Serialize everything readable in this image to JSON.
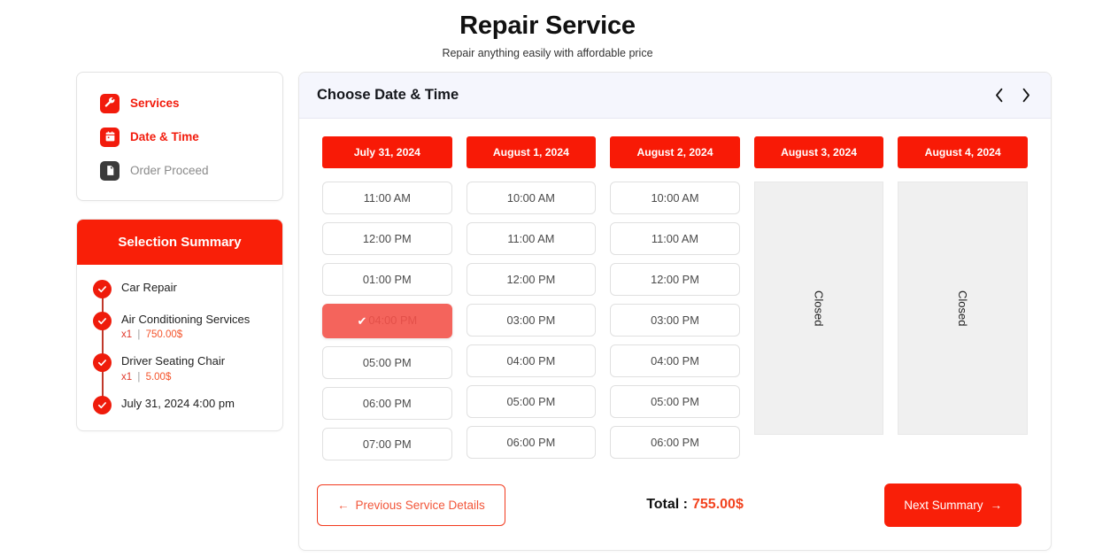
{
  "header": {
    "title": "Repair Service",
    "subtitle": "Repair anything easily with affordable price"
  },
  "sidebar": {
    "items": [
      {
        "label": "Services",
        "icon": "wrench-icon",
        "state": "active"
      },
      {
        "label": "Date & Time",
        "icon": "calendar-icon",
        "state": "active"
      },
      {
        "label": "Order Proceed",
        "icon": "document-icon",
        "state": "idle"
      }
    ]
  },
  "summary": {
    "title": "Selection Summary",
    "items": [
      {
        "name": "Car Repair",
        "qty": "",
        "sep": "",
        "price": ""
      },
      {
        "name": "Air Conditioning Services",
        "qty": "x1",
        "sep": "|",
        "price": "750.00$"
      },
      {
        "name": "Driver Seating Chair",
        "qty": "x1",
        "sep": "|",
        "price": "5.00$"
      },
      {
        "name": "July 31, 2024 4:00 pm",
        "qty": "",
        "sep": "",
        "price": ""
      }
    ]
  },
  "panel": {
    "title": "Choose Date & Time",
    "prev_icon": "chevron-left-icon",
    "next_icon": "chevron-right-icon"
  },
  "calendar": {
    "columns": [
      {
        "date": "July 31, 2024",
        "closed": false,
        "closed_label": "",
        "slots": [
          {
            "time": "11:00 AM",
            "selected": false
          },
          {
            "time": "12:00 PM",
            "selected": false
          },
          {
            "time": "01:00 PM",
            "selected": false
          },
          {
            "time": "04:00 PM",
            "selected": true
          },
          {
            "time": "05:00 PM",
            "selected": false
          },
          {
            "time": "06:00 PM",
            "selected": false
          },
          {
            "time": "07:00 PM",
            "selected": false
          }
        ]
      },
      {
        "date": "August 1, 2024",
        "closed": false,
        "closed_label": "",
        "slots": [
          {
            "time": "10:00 AM",
            "selected": false
          },
          {
            "time": "11:00 AM",
            "selected": false
          },
          {
            "time": "12:00 PM",
            "selected": false
          },
          {
            "time": "03:00 PM",
            "selected": false
          },
          {
            "time": "04:00 PM",
            "selected": false
          },
          {
            "time": "05:00 PM",
            "selected": false
          },
          {
            "time": "06:00 PM",
            "selected": false
          }
        ]
      },
      {
        "date": "August 2, 2024",
        "closed": false,
        "closed_label": "",
        "slots": [
          {
            "time": "10:00 AM",
            "selected": false
          },
          {
            "time": "11:00 AM",
            "selected": false
          },
          {
            "time": "12:00 PM",
            "selected": false
          },
          {
            "time": "03:00 PM",
            "selected": false
          },
          {
            "time": "04:00 PM",
            "selected": false
          },
          {
            "time": "05:00 PM",
            "selected": false
          },
          {
            "time": "06:00 PM",
            "selected": false
          }
        ]
      },
      {
        "date": "August 3, 2024",
        "closed": true,
        "closed_label": "Closed",
        "slots": []
      },
      {
        "date": "August 4, 2024",
        "closed": true,
        "closed_label": "Closed",
        "slots": []
      }
    ]
  },
  "footer": {
    "prev_label": "Previous Service Details",
    "prev_arrow": "←",
    "total_label": "Total :",
    "total_amount": "755.00$",
    "next_label": "Next Summary",
    "next_arrow": "→"
  },
  "colors": {
    "brand_red": "#f91f08",
    "selected_slot": "#f4645c",
    "header_bg": "#f5f6fd",
    "closed_bg": "#f0f0f0"
  }
}
